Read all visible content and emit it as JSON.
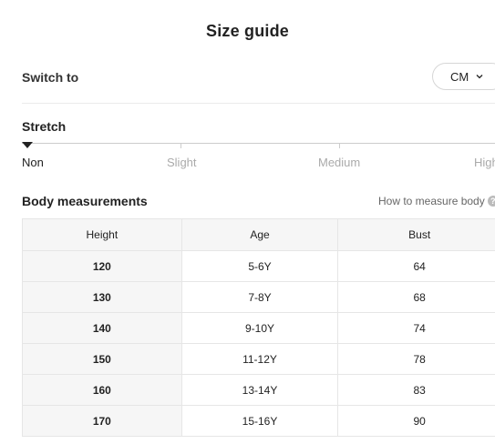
{
  "header": {
    "title": "Size guide"
  },
  "unit_switch": {
    "label": "Switch to",
    "selected": "CM"
  },
  "stretch": {
    "label": "Stretch",
    "levels": [
      "Non",
      "Slight",
      "Medium",
      "High"
    ],
    "selected": "Non"
  },
  "body_measurements": {
    "label": "Body measurements",
    "help_link": "How to measure body",
    "help_icon": "?",
    "columns": [
      "Height",
      "Age",
      "Bust"
    ],
    "rows": [
      [
        "120",
        "5-6Y",
        "64"
      ],
      [
        "130",
        "7-8Y",
        "68"
      ],
      [
        "140",
        "9-10Y",
        "74"
      ],
      [
        "150",
        "11-12Y",
        "78"
      ],
      [
        "160",
        "13-14Y",
        "83"
      ],
      [
        "170",
        "15-16Y",
        "90"
      ]
    ]
  },
  "colors": {
    "accent": "#222222",
    "muted": "#aaaaaa",
    "header_bg": "#f6f6f6"
  }
}
